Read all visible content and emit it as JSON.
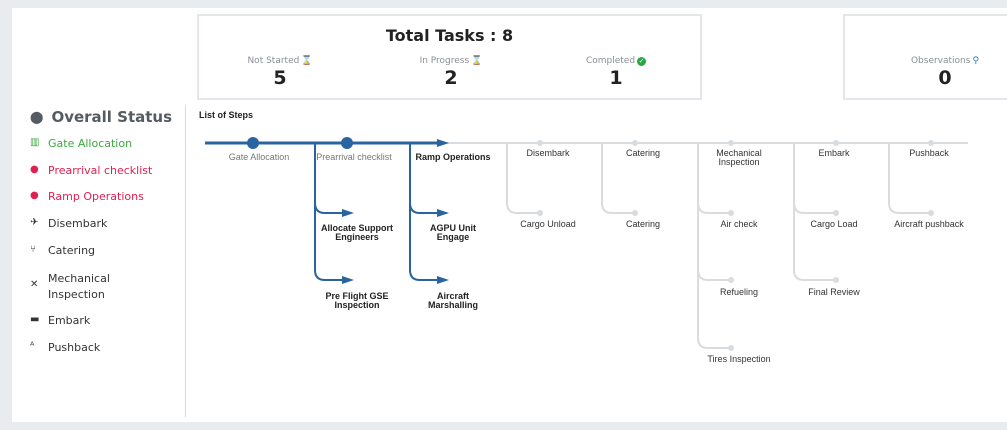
{
  "summary": {
    "title": "Total Tasks : 8",
    "not_started": {
      "label": "Not Started",
      "value": "5",
      "icon": "hourglass-icon"
    },
    "in_progress": {
      "label": "In Progress",
      "value": "2",
      "icon": "hourglass-icon"
    },
    "completed": {
      "label": "Completed",
      "value": "1",
      "icon": "check-circle-icon"
    }
  },
  "observations": {
    "label": "Observations",
    "value": "0",
    "icon": "search-icon"
  },
  "sidebar": {
    "title": "Overall Status",
    "items": [
      {
        "label": "Gate Allocation",
        "icon": "building-icon",
        "status": "#3aaa3e"
      },
      {
        "label": "Prearrival checklist",
        "icon": "bomb-icon",
        "status": "#e02050"
      },
      {
        "label": "Ramp Operations",
        "icon": "bomb-icon",
        "status": "#e02050"
      },
      {
        "label": "Disembark",
        "icon": "plane-landing-icon",
        "status": "#333333"
      },
      {
        "label": "Catering",
        "icon": "cutlery-icon",
        "status": "#333333"
      },
      {
        "label": "Mechanical Inspection",
        "icon": "wrench-icon",
        "status": "#333333"
      },
      {
        "label": "Embark",
        "icon": "truck-icon",
        "status": "#333333"
      },
      {
        "label": "Pushback",
        "icon": "tower-icon",
        "status": "#333333"
      }
    ]
  },
  "steps": {
    "title": "List of Steps",
    "main": [
      "Gate Allocation",
      "Prearrival checklist",
      "Ramp Operations",
      "Disembark",
      "Catering",
      "Mechanical Inspection",
      "Embark",
      "Pushback"
    ],
    "sub": {
      "prearrival": [
        "Allocate Support Engineers",
        "Pre Flight GSE Inspection"
      ],
      "ramp": [
        "AGPU Unit Engage",
        "Aircraft Marshalling"
      ],
      "disembark": [
        "Cargo Unload"
      ],
      "catering": [
        "Catering"
      ],
      "mechanical": [
        "Air check",
        "Refueling",
        "Tires Inspection"
      ],
      "embark": [
        "Cargo Load",
        "Final Review"
      ],
      "pushback": [
        "Aircraft pushback"
      ]
    }
  },
  "colors": {
    "accent": "#2a64a0",
    "pending": "#d9dcdf",
    "done": "#3aaa3e",
    "alert": "#e02050"
  }
}
